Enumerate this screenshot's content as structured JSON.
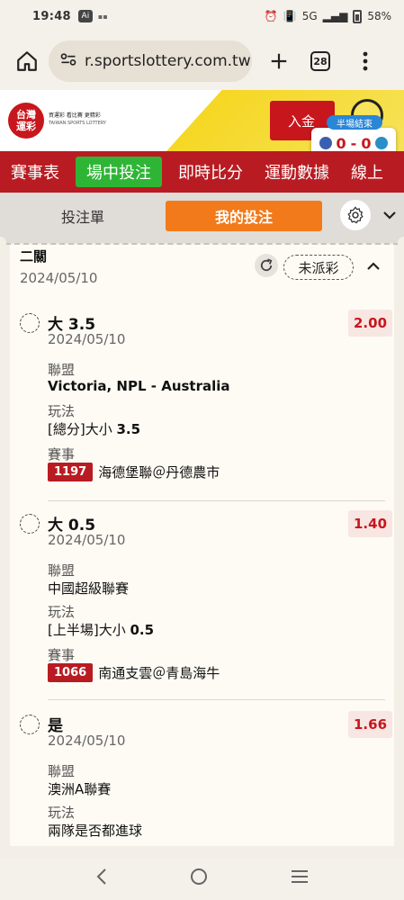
{
  "status_bar": {
    "time": "19:48",
    "ai_badge": "Ai",
    "network": "5G",
    "battery": "58%"
  },
  "browser": {
    "url": "r.sportslottery.com.tw",
    "tab_count": "28"
  },
  "site": {
    "logo_line1": "台灣",
    "logo_line2": "運彩",
    "slogan": "買運彩 看比賽 更精彩",
    "slogan_en": "TAIWAN SPORTS LOTTERY",
    "deposit_label": "入金"
  },
  "live_score": {
    "status": "半場結束",
    "home": "0",
    "sep": "-",
    "away": "0"
  },
  "nav": {
    "items": [
      "賽事表",
      "場中投注",
      "即時比分",
      "運動數據",
      "線上"
    ]
  },
  "bet_panel": {
    "tab_slip": "投注單",
    "tab_mybets": "我的投注"
  },
  "combo": {
    "title": "二關",
    "date": "2024/05/10",
    "status": "未派彩"
  },
  "bets": [
    {
      "selection": "大 3.5",
      "date": "2024/05/10",
      "odds": "2.00",
      "league_label": "聯盟",
      "league": "Victoria, NPL - Australia",
      "market_label": "玩法",
      "market_prefix": "[總分]大小 ",
      "market_value": "3.5",
      "event_label": "賽事",
      "match_no": "1197",
      "match": "海德堡聯＠丹德農市"
    },
    {
      "selection": "大 0.5",
      "date": "2024/05/10",
      "odds": "1.40",
      "league_label": "聯盟",
      "league": "中國超級聯賽",
      "market_label": "玩法",
      "market_prefix": "[上半場]大小 ",
      "market_value": "0.5",
      "event_label": "賽事",
      "match_no": "1066",
      "match": "南通支雲＠青島海牛"
    },
    {
      "selection": "是",
      "date": "2024/05/10",
      "odds": "1.66",
      "league_label": "聯盟",
      "league": "澳洲A聯賽",
      "market_label": "玩法",
      "market_prefix": "兩隊是否都進球",
      "market_value": ""
    }
  ],
  "icons": {
    "home": "home-icon",
    "tune": "tune-icon",
    "plus": "plus-icon",
    "menu": "more-vert-icon",
    "gear": "gear-icon",
    "refresh": "refresh-icon",
    "back": "back-icon",
    "home_nav": "home-nav-icon",
    "recents": "recents-icon"
  }
}
